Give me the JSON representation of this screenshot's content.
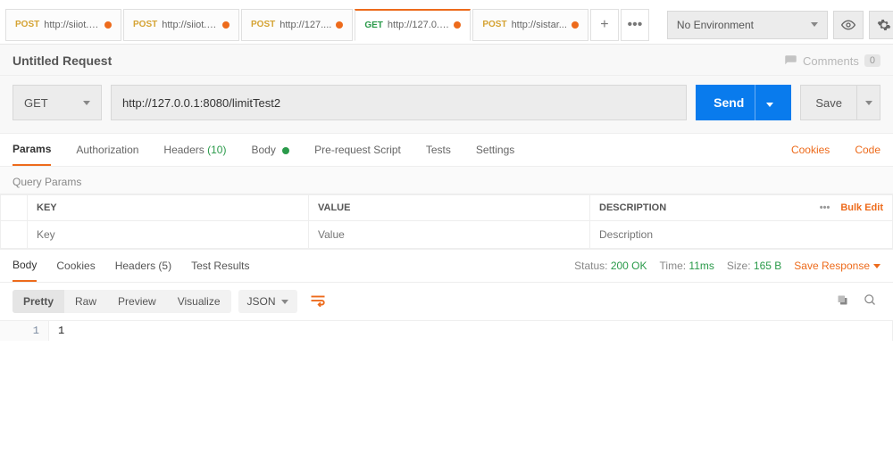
{
  "env": {
    "selected": "No Environment"
  },
  "tabs": [
    {
      "method": "POST",
      "method_cls": "post",
      "url": "http://siiot.e..."
    },
    {
      "method": "POST",
      "method_cls": "post",
      "url": "http://siiot.e..."
    },
    {
      "method": "POST",
      "method_cls": "post",
      "url": "http://127...."
    },
    {
      "method": "GET",
      "method_cls": "get",
      "url": "http://127.0.0...",
      "active": true
    },
    {
      "method": "POST",
      "method_cls": "post",
      "url": "http://sistar..."
    }
  ],
  "request": {
    "title": "Untitled Request",
    "comments_label": "Comments",
    "comments_count": "0",
    "method": "GET",
    "url": "http://127.0.0.1:8080/limitTest2",
    "send": "Send",
    "save": "Save"
  },
  "req_tabs": {
    "params": "Params",
    "auth": "Authorization",
    "headers": "Headers",
    "headers_count": "(10)",
    "body": "Body",
    "prereq": "Pre-request Script",
    "tests": "Tests",
    "settings": "Settings",
    "cookies": "Cookies",
    "code": "Code"
  },
  "qp": {
    "title": "Query Params",
    "key": "KEY",
    "value": "VALUE",
    "desc": "DESCRIPTION",
    "key_ph": "Key",
    "value_ph": "Value",
    "desc_ph": "Description",
    "bulk": "Bulk Edit"
  },
  "resp_tabs": {
    "body": "Body",
    "cookies": "Cookies",
    "headers": "Headers",
    "headers_count": "(5)",
    "tests": "Test Results",
    "status_lbl": "Status:",
    "status_val": "200 OK",
    "time_lbl": "Time:",
    "time_val": "11ms",
    "size_lbl": "Size:",
    "size_val": "165 B",
    "save": "Save Response"
  },
  "view": {
    "pretty": "Pretty",
    "raw": "Raw",
    "preview": "Preview",
    "visualize": "Visualize",
    "format": "JSON"
  },
  "body": {
    "line_no": "1",
    "content": "1"
  }
}
